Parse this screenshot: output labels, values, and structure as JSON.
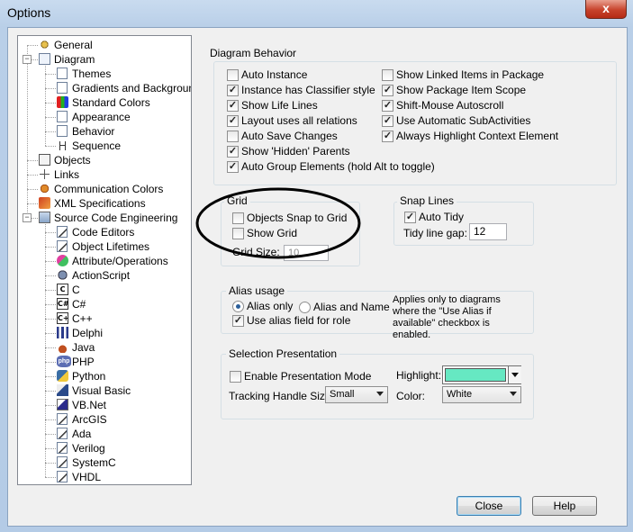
{
  "window": {
    "title": "Options",
    "close_glyph": "x"
  },
  "tree": {
    "items": [
      {
        "label": "General",
        "icon": "general-icon"
      },
      {
        "label": "Diagram",
        "icon": "diagram-icon"
      },
      {
        "label": "Themes",
        "icon": "page-icon"
      },
      {
        "label": "Gradients and Background",
        "icon": "page-icon"
      },
      {
        "label": "Standard Colors",
        "icon": "colors-icon"
      },
      {
        "label": "Appearance",
        "icon": "page-icon"
      },
      {
        "label": "Behavior",
        "icon": "page-icon"
      },
      {
        "label": "Sequence",
        "icon": "sequence-icon"
      },
      {
        "label": "Objects",
        "icon": "objects-icon"
      },
      {
        "label": "Links",
        "icon": "links-icon"
      },
      {
        "label": "Communication Colors",
        "icon": "communication-icon"
      },
      {
        "label": "XML Specifications",
        "icon": "xml-icon"
      },
      {
        "label": "Source Code Engineering",
        "icon": "source-code-icon"
      },
      {
        "label": "Code Editors",
        "icon": "edit-icon"
      },
      {
        "label": "Object Lifetimes",
        "icon": "edit-icon"
      },
      {
        "label": "Attribute/Operations",
        "icon": "attribute-icon"
      },
      {
        "label": "ActionScript",
        "icon": "actionscript-icon"
      },
      {
        "label": "C",
        "icon": "c-icon"
      },
      {
        "label": "C#",
        "icon": "csharp-icon"
      },
      {
        "label": "C++",
        "icon": "cpp-icon"
      },
      {
        "label": "Delphi",
        "icon": "delphi-icon"
      },
      {
        "label": "Java",
        "icon": "java-icon"
      },
      {
        "label": "PHP",
        "icon": "php-icon"
      },
      {
        "label": "Python",
        "icon": "python-icon"
      },
      {
        "label": "Visual Basic",
        "icon": "visual-basic-icon"
      },
      {
        "label": "VB.Net",
        "icon": "vbnet-icon"
      },
      {
        "label": "ArcGIS",
        "icon": "edit-icon"
      },
      {
        "label": "Ada",
        "icon": "edit-icon"
      },
      {
        "label": "Verilog",
        "icon": "edit-icon"
      },
      {
        "label": "SystemC",
        "icon": "edit-icon"
      },
      {
        "label": "VHDL",
        "icon": "edit-icon"
      }
    ],
    "glyphs": {
      "c": "C",
      "csharp": "C#",
      "cpp": "C+",
      "php": "php",
      "collapse": "−"
    }
  },
  "behavior": {
    "group_title": "Diagram Behavior",
    "left": [
      {
        "label": "Auto Instance",
        "checked": false
      },
      {
        "label": "Instance has Classifier style",
        "checked": true
      },
      {
        "label": "Show Life Lines",
        "checked": true
      },
      {
        "label": "Layout uses all relations",
        "checked": true
      },
      {
        "label": "Auto Save Changes",
        "checked": false
      },
      {
        "label": "Show 'Hidden' Parents",
        "checked": true
      },
      {
        "label": "Auto Group Elements (hold Alt to toggle)",
        "checked": true
      }
    ],
    "right": [
      {
        "label": "Show Linked Items in Package",
        "checked": false
      },
      {
        "label": "Show Package Item Scope",
        "checked": true
      },
      {
        "label": "Shift-Mouse Autoscroll",
        "checked": true
      },
      {
        "label": "Use Automatic SubActivities",
        "checked": true
      },
      {
        "label": "Always Highlight Context Element",
        "checked": true
      }
    ],
    "check_glyph": "✓"
  },
  "grid": {
    "title": "Grid",
    "snap_label": "Objects Snap to Grid",
    "snap_checked": false,
    "show_label": "Show Grid",
    "show_checked": false,
    "size_label": "Grid Size:",
    "size_value": "10"
  },
  "snap_lines": {
    "title": "Snap Lines",
    "auto_tidy_label": "Auto Tidy",
    "auto_tidy_checked": true,
    "gap_label": "Tidy line gap:",
    "gap_value": "12"
  },
  "alias": {
    "title": "Alias usage",
    "alias_only": "Alias only",
    "alias_and_name": "Alias and Name",
    "selected": "Alias only",
    "use_field_label": "Use alias field for role",
    "use_field_checked": true,
    "note": "Applies only to diagrams where the \"Use Alias if available\" checkbox is enabled."
  },
  "selection": {
    "title": "Selection Presentation",
    "enable_label": "Enable Presentation Mode",
    "enable_checked": false,
    "highlight_label": "Highlight:",
    "highlight_color": "#66e8c2",
    "handle_label": "Tracking Handle Size:",
    "handle_value": "Small",
    "color_label": "Color:",
    "color_value": "White"
  },
  "buttons": {
    "close": "Close",
    "help": "Help"
  }
}
